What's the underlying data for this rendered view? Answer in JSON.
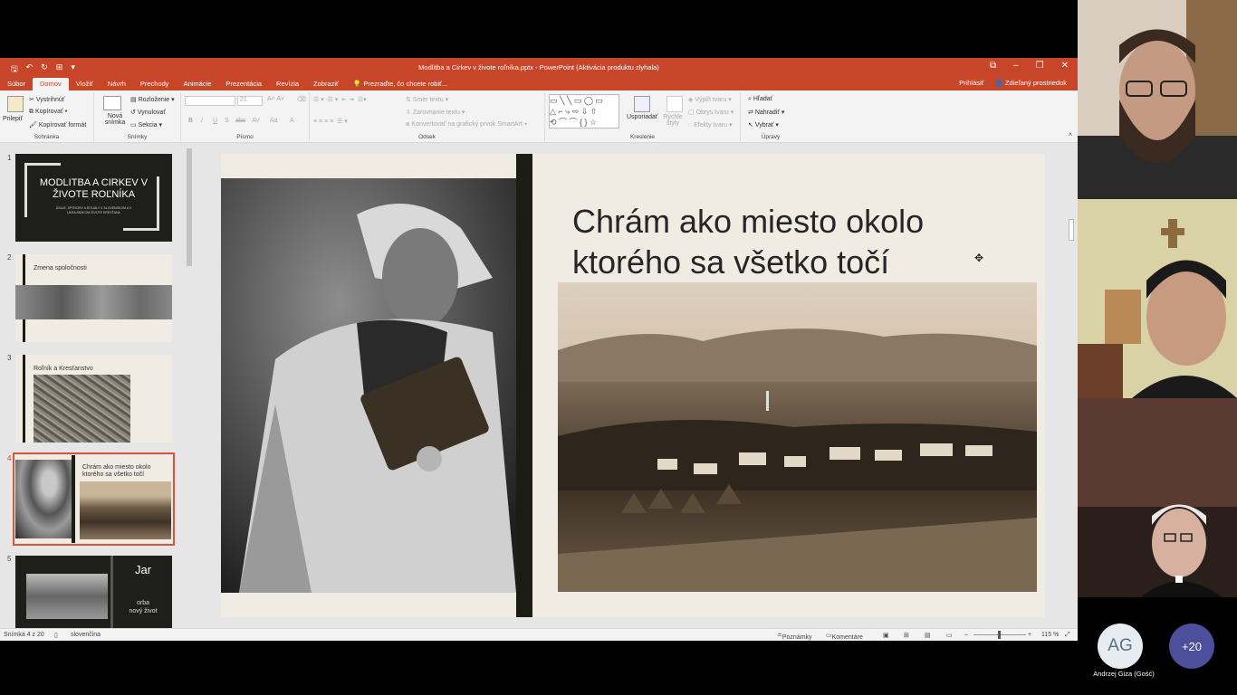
{
  "window": {
    "title": "Modlitba a Cirkev v živote roľníka.pptx - PowerPoint (Aktivácia produktu zlyhala)",
    "qat_icons": [
      "save-icon",
      "undo-icon",
      "redo-icon",
      "present-icon"
    ],
    "controls": [
      "⧉",
      "–",
      "❐",
      "✕"
    ]
  },
  "tabs": [
    "Súbor",
    "Domov",
    "Vložiť",
    "Návrh",
    "Prechody",
    "Animácie",
    "Prezentácia",
    "Revízia",
    "Zobraziť"
  ],
  "active_tab": "Domov",
  "tell_me": "Prezraďte, čo chcete robiť...",
  "signin": "Prihlásiť",
  "share": "Zdieľaný prostriedok",
  "ribbon": {
    "clipboard": {
      "paste": "Prilepiť",
      "cut": "Vystrihnúť",
      "copy": "Kopírovať",
      "format": "Kopírovať formát",
      "name": "Schránka"
    },
    "slides": {
      "new": "Nová snímka",
      "layout": "Rozloženie",
      "reset": "Vynulovať",
      "section": "Sekcia",
      "name": "Snímky"
    },
    "font": {
      "size": "21",
      "name": "Písmo",
      "buttons": [
        "B",
        "I",
        "U",
        "S",
        "abc",
        "AV",
        "Aa",
        "A"
      ]
    },
    "paragraph": {
      "direction": "Smer textu",
      "align": "Zarovnanie textu",
      "smartart": "Konvertovať na grafický prvok SmartArt",
      "name": "Odsek"
    },
    "drawing": {
      "arrange": "Usporiadať",
      "quick_styles": "Rýchle štýly",
      "fill": "Výplň tvaru",
      "outline": "Obrys tvaru",
      "effects": "Efekty tvaru",
      "name": "Kreslenie"
    },
    "editing": {
      "find": "Hľadať",
      "replace": "Nahradiť",
      "select": "Vybrať",
      "name": "Úpravy"
    }
  },
  "thumbnails": [
    {
      "num": "1",
      "title": "MODLITBA A CIRKEV V ŽIVOTE ROĽNÍKA",
      "subtitle": "ÚSILIE, SPÔSOBY A RITUÁLY V SLOVENSKOM A V UKRAJINSKOM ŽIVOTE KRESŤANA"
    },
    {
      "num": "2",
      "title": "Zmena spoločnosti"
    },
    {
      "num": "3",
      "title": "Roľník a Kresťanstvo"
    },
    {
      "num": "4",
      "title": "Chrám ako miesto okolo ktorého sa všetko točí"
    },
    {
      "num": "5",
      "title": "Jar",
      "body": "orba\nnový život"
    }
  ],
  "slide": {
    "title": "Chrám ako miesto okolo ktorého sa všetko točí"
  },
  "status": {
    "slide": "Snímka 4 z 20",
    "language": "slovenčina",
    "notes": "Poznámky",
    "comments": "Komentáre",
    "zoom": "115 %"
  },
  "participants": {
    "initials": "AG",
    "name": "Andrzej Giza (Gość)",
    "more": "+20"
  }
}
